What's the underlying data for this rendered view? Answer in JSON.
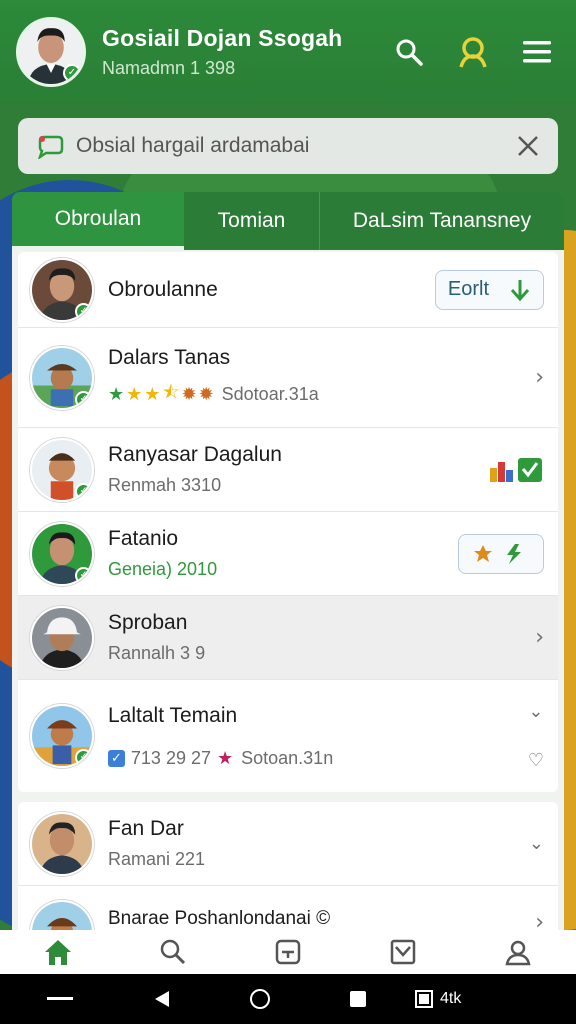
{
  "header": {
    "title": "Gosiail Dojan Ssogah",
    "subtitle": "Namadmn 1 398",
    "icons": [
      "search-icon",
      "profile-icon",
      "menu-icon"
    ]
  },
  "search": {
    "value": "Obsial hargail ardamabai"
  },
  "tabs": [
    {
      "label": "Obroulan",
      "active": true
    },
    {
      "label": "Tomian",
      "active": false
    },
    {
      "label": "DaLsim Tanansney",
      "active": false
    }
  ],
  "list": {
    "items": [
      {
        "name": "Obroulanne",
        "action_label": "Eorlt"
      },
      {
        "name": "Dalars Tanas",
        "rating": 3.5,
        "meta": "Sdotoar.31a"
      },
      {
        "name": "Ranyasar Dagalun",
        "sub": "Renmah 3310"
      },
      {
        "name": "Fatanio",
        "sub": "Geneia) 2010"
      },
      {
        "name": "Sproban",
        "sub": "Rannalh 3 9"
      },
      {
        "name": "Laltalt Temain",
        "count_text": "713 29 27",
        "meta": "Sotoan.31n"
      },
      {
        "name": "Fan Dar",
        "sub": "Ramani 221"
      },
      {
        "name": "Bnarae Poshanlondanai ©"
      }
    ]
  },
  "bottom_nav": [
    "home-icon",
    "search-icon",
    "inbox-icon",
    "mail-icon",
    "profile-icon"
  ],
  "system_bar": {
    "label": "4tk"
  },
  "colors": {
    "primary_green": "#2c8a3a",
    "accent_green": "#2f9a3c",
    "star_gold": "#f2b705"
  }
}
